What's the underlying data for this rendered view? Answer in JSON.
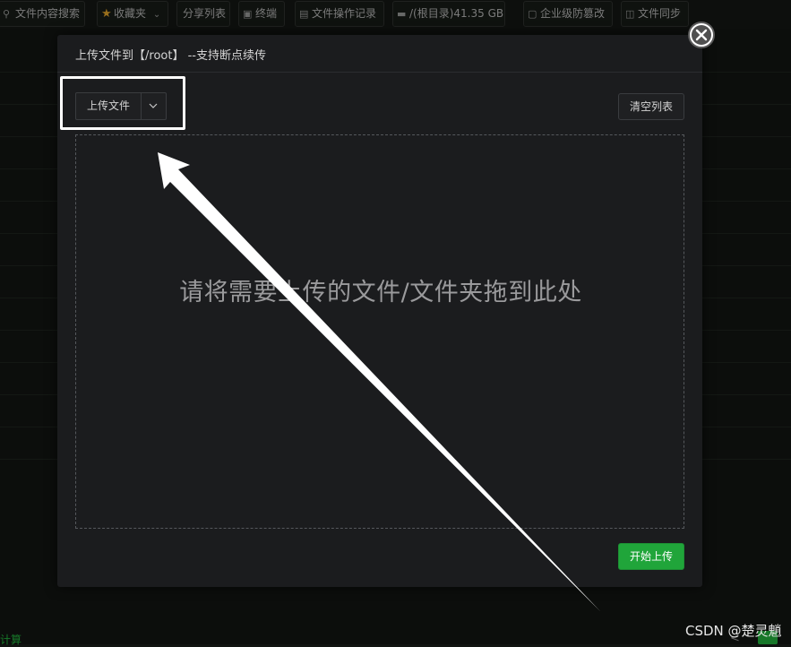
{
  "toolbar": {
    "items": [
      {
        "label": "文件内容搜索",
        "icon": "search-icon"
      },
      {
        "label": "收藏夹",
        "icon": "star-icon"
      },
      {
        "label": "分享列表"
      },
      {
        "label": "终端",
        "icon": "terminal-icon"
      },
      {
        "label": "文件操作记录",
        "icon": "file-log-icon"
      },
      {
        "label": "/(根目录)41.35 GB",
        "icon": "disk-icon"
      },
      {
        "label": "企业级防篡改",
        "icon": "shield-icon"
      },
      {
        "label": "文件同步",
        "icon": "folder-sync-icon"
      }
    ]
  },
  "modal": {
    "title": "上传文件到【/root】 --支持断点续传",
    "upload_button": "上传文件",
    "clear_button": "清空列表",
    "drop_hint": "请将需要上传的文件/文件夹拖到此处",
    "start_button": "开始上传"
  },
  "footer": {
    "left_text": "计算",
    "watermark": "CSDN @楚灵魈",
    "pager_prev": "<"
  },
  "colors": {
    "accent": "#20a53a",
    "modal_bg": "#1b1c1e",
    "page_bg": "#111411",
    "annotation": "#ffffff"
  }
}
